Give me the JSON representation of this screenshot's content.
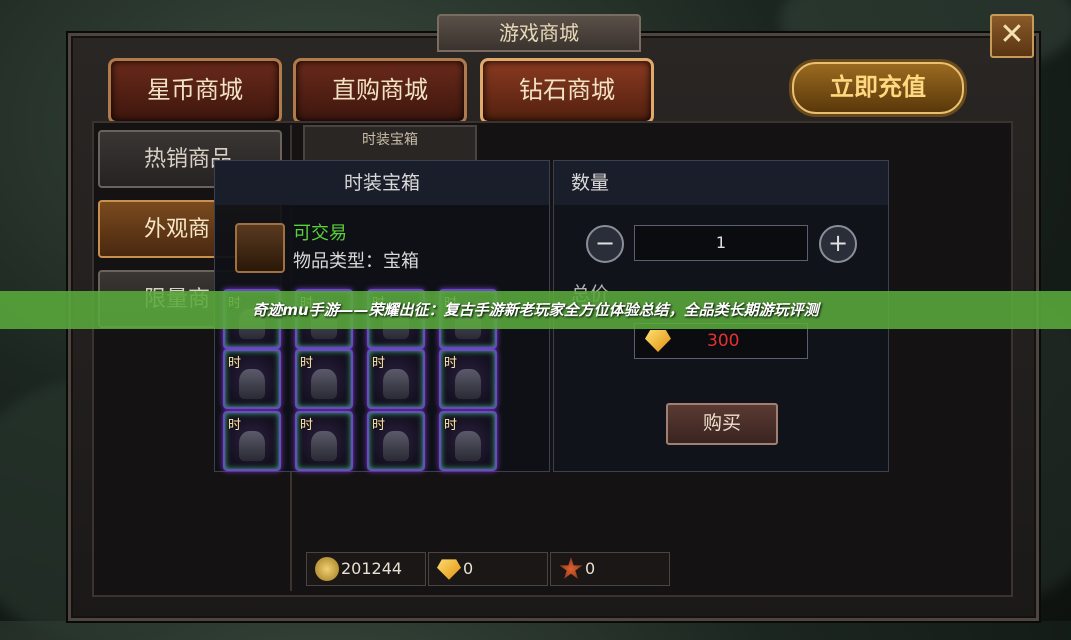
{
  "window": {
    "title": "游戏商城",
    "close_glyph": "✕"
  },
  "top_tabs": [
    {
      "label": "星币商城"
    },
    {
      "label": "直购商城"
    },
    {
      "label": "钻石商城"
    }
  ],
  "recharge_label": "立即充值",
  "side_tabs": [
    {
      "label": "热销商品"
    },
    {
      "label": "外观商"
    },
    {
      "label": "限量商"
    }
  ],
  "item_card": {
    "title": "时装宝箱"
  },
  "popup": {
    "item_title": "时装宝箱",
    "tradable": "可交易",
    "item_type": "物品类型：宝箱",
    "grid_tag": "时",
    "quantity_header": "数量",
    "quantity_value": "1",
    "minus": "−",
    "plus": "+",
    "total_label": "总价",
    "price": "300",
    "buy_label": "购买"
  },
  "currencies": [
    {
      "icon": "silver-coin-icon",
      "value": "201244"
    },
    {
      "icon": "diamond-icon",
      "value": "0"
    },
    {
      "icon": "honor-badge-icon",
      "value": "0"
    }
  ],
  "banner": {
    "text": "奇迹mu手游——荣耀出征：复古手游新老玩家全方位体验总结，全品类长期游玩评测"
  },
  "colors": {
    "tradable": "#5ad03a",
    "price": "#e83030",
    "banner": "#5aaa3c"
  }
}
